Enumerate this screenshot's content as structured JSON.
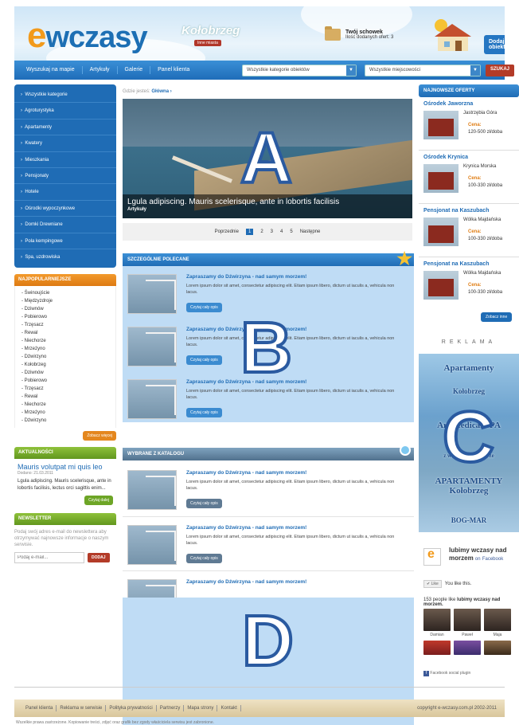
{
  "header": {
    "logo_e": "e",
    "logo_text": "wczasy",
    "logo_city": "Kołobrzeg",
    "city_badge": "Inne miasta",
    "schowek_title": "Twój schowek",
    "schowek_count": "Ilość dodanych ofert: 3",
    "add_button": "Dodaj obiekt"
  },
  "nav": {
    "items": [
      "Wyszukaj na mapie",
      "Artykuły",
      "Galerie",
      "Panel klienta"
    ],
    "category_select": "Wszystkie kategorie obiektów",
    "location_select": "Wszystkie miejscowości",
    "search_button": "SZUKAJ"
  },
  "left": {
    "categories": [
      "Wszystkie kategorie",
      "Agroturystyka",
      "Apartamenty",
      "Kwatery",
      "Mieszkania",
      "Pensjonaty",
      "Hotele",
      "Ośrodki wypoczynkowe",
      "Domki Drewniane",
      "Pola kempingowe",
      "Spa, uzdrowiska"
    ],
    "popular_title": "NAJPOPULARNIEJSZE",
    "popular": [
      "Świnoujście",
      "Międzyzdroje",
      "Dziwnów",
      "Pobierowo",
      "Trzęsacz",
      "Rewal",
      "Niechorze",
      "Mrzeżyno",
      "Dźwirzyno",
      "Kołobrzeg",
      "Dziwnów",
      "Pobierowo",
      "Trzęsacz",
      "Rewal",
      "Niechorze",
      "Mrzeżyno",
      "Dźwirzyno"
    ],
    "popular_more": "Zobacz więcej",
    "news_header": "AKTUALNOŚCI",
    "news_title": "Mauris volutpat mi quis leo",
    "news_date": "Dodano: 21.03.2011",
    "news_text": "Lgula adipiscing. Mauris scelerisque, ante in lobortis facilisis, lectus orci sagittis enim...",
    "news_more": "Czytaj dalej",
    "newsletter_header": "NEWSLETTER",
    "newsletter_text": "Podaj swój adres e-mail do newslettera aby otrzymywać najnowsze informacje o naszym serwisie.",
    "newsletter_placeholder": "Podaj e-mail...",
    "newsletter_button": "DODAJ"
  },
  "center": {
    "breadcrumb_label": "Gdzie jesteś:",
    "breadcrumb_link": "Główna ›",
    "slider_caption": "Lgula adipiscing. Mauris scelerisque, ante in lobortis facilisis",
    "slider_category": "Artykuły",
    "pager_prev": "Poprzednie",
    "pager_pages": [
      "1",
      "2",
      "3",
      "4",
      "5"
    ],
    "pager_next": "Następne",
    "recommended_title": "SZCZEGÓLNIE POLECANE",
    "catalog_title": "WYBRANE Z KATALOGU",
    "offer_title": "Zapraszamy do Dźwirzyna - nad samym morzem!",
    "offer_text": "Lorem ipsum dolor sit amet, consectetur adipiscing elit. Etiam ipsum libero, dictum ut iaculis a, vehicula non lacus.",
    "offer_button": "Czytaj cały opis"
  },
  "right": {
    "offers_title": "NAJNOWSZE OFERTY",
    "offers": [
      {
        "name": "Ośrodek Jaworzna",
        "location": "Jastrzębia Góra",
        "price_label": "Cena:",
        "price": "120-500 zł/doba"
      },
      {
        "name": "Ośrodek Krynica",
        "location": "Krynica Morska",
        "price_label": "Cena:",
        "price": "100-330 zł/doba"
      },
      {
        "name": "Pensjonat na Kaszubach",
        "location": "Wólka Majdańska",
        "price_label": "Cena:",
        "price": "100-330 zł/doba"
      },
      {
        "name": "Pensjonat na Kaszubach",
        "location": "Wólka Majdańska",
        "price_label": "Cena:",
        "price": "100-330 zł/doba"
      }
    ],
    "see_more": "Zobacz inne",
    "ads_label": "REKLAMA",
    "ads": [
      "Apartamenty",
      "Kołobrzeg",
      "Art Medical SPA",
      "z widokiem na morze",
      "APARTAMENTY Kołobrzeg",
      "BOG-MAR"
    ],
    "fb_name": "lubimy wczasy nad morzem",
    "fb_on": "on",
    "fb_brand": "Facebook",
    "fb_like": "Like",
    "fb_you_like": "You like this.",
    "fb_count_text": "153 people like",
    "fb_count_bold": "lubimy wczasy nad morzem.",
    "fb_people": [
      "Damian",
      "Paweł",
      "Maja"
    ],
    "fb_plugin": "Facebook social plugin"
  },
  "overlay_letters": [
    "A",
    "B",
    "C",
    "D"
  ],
  "footer": {
    "links": [
      "Panel klienta",
      "Reklama w serwisie",
      "Polityka prywatności",
      "Partnerzy",
      "Mapa strony",
      "Kontakt"
    ],
    "copyright": "copyright e-wczasy.com.pl 2002-2011",
    "bottom_text": "Wszelkie prawa zastrzeżone. Kopiowanie treści, zdjęć oraz grafik bez zgody właściciela serwisu jest zabronione."
  }
}
